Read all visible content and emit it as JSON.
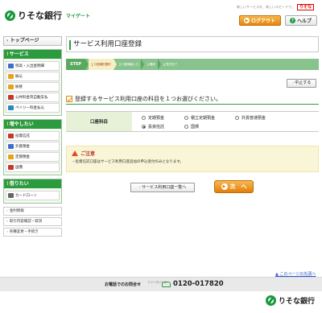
{
  "header": {
    "logo_text": "りそな銀行",
    "logo_sub": "マイゲート",
    "tagline": "新しいサービスを、新しいスピードで。",
    "tagline_brand": "りそな",
    "logout_label": "ログアウト",
    "help_label": "ヘルプ"
  },
  "sidebar": {
    "top_label": "トップページ",
    "sections": [
      {
        "title": "サービス",
        "items": [
          {
            "label": "残高・入出金明細",
            "color": "#3b6fc9"
          },
          {
            "label": "振込",
            "color": "#e8a31d"
          },
          {
            "label": "振替",
            "color": "#e8a31d"
          },
          {
            "label": "公共料金等自動支払",
            "color": "#c0392b"
          },
          {
            "label": "ペイジー料金払込",
            "color": "#2e86c1"
          }
        ]
      },
      {
        "title": "増やしたい",
        "items": [
          {
            "label": "投資信託",
            "color": "#c0392b"
          },
          {
            "label": "外貨預金",
            "color": "#3b6fc9"
          },
          {
            "label": "定期預金",
            "color": "#e8a31d"
          },
          {
            "label": "国債",
            "color": "#c0392b"
          }
        ]
      },
      {
        "title": "借りたい",
        "items": [
          {
            "label": "カードローン",
            "color": "#666666"
          }
        ]
      }
    ],
    "links": [
      "金利情報",
      "取引内容確認・取消",
      "各種変更・手続き"
    ]
  },
  "main": {
    "page_title": "サービス利用口座登録",
    "step_label": "STEP",
    "steps": [
      {
        "num": "1",
        "label": "口座種別選択"
      },
      {
        "num": "2",
        "label": "口座情報入力"
      },
      {
        "num": "3",
        "label": "確認"
      },
      {
        "num": "4",
        "label": "受付完了"
      }
    ],
    "cancel_label": "中止する",
    "instruction": "登録するサービス利用口座の科目を１つお選びください。",
    "field_label": "口座科目",
    "options": [
      {
        "label": "定期預金",
        "selected": false
      },
      {
        "label": "積立定期預金",
        "selected": false
      },
      {
        "label": "外貨普通預金",
        "selected": false
      },
      {
        "label": "投資信託",
        "selected": true
      },
      {
        "label": "国債",
        "selected": false
      }
    ],
    "notice_title": "ご注意",
    "notice_body": "・投資信託口座はサービス利用口座追加の申込受付のみとなります。",
    "list_button": "サービス利用口座一覧へ",
    "next_button": "次　へ",
    "page_top_link": "このページの先頭へ"
  },
  "footer": {
    "contact_label": "お電話でのお問合せ",
    "contact_sub": "フリーダイヤル",
    "phone": "0120-017820",
    "logo_text": "りそな銀行"
  },
  "colors": {
    "brand_green": "#2c9b3f",
    "accent_orange": "#e4860c",
    "alert_red": "#c0392b"
  }
}
